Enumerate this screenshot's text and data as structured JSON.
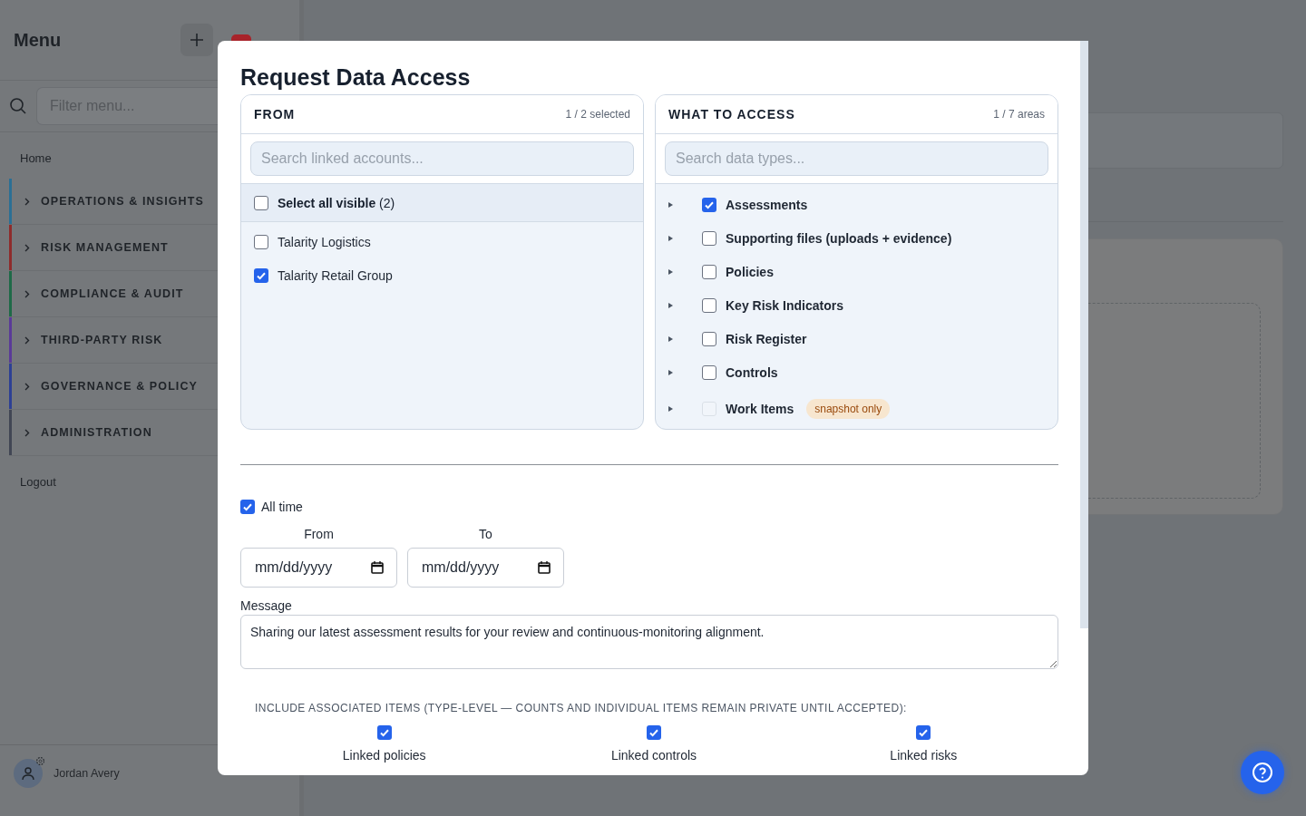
{
  "sidebar": {
    "title": "Menu",
    "filter": {
      "placeholder": "Filter menu..."
    },
    "items": [
      {
        "kind": "link",
        "label": "Home"
      },
      {
        "kind": "group",
        "label": "OPERATIONS & INSIGHTS",
        "color": "#2b6f95"
      },
      {
        "kind": "group",
        "label": "RISK MANAGEMENT",
        "color": "#8e2b2b"
      },
      {
        "kind": "group",
        "label": "COMPLIANCE & AUDIT",
        "color": "#1e6a47"
      },
      {
        "kind": "group",
        "label": "THIRD-PARTY RISK",
        "color": "#5a3a98"
      },
      {
        "kind": "group",
        "label": "GOVERNANCE & POLICY",
        "color": "#2d4094"
      },
      {
        "kind": "group",
        "label": "ADMINISTRATION",
        "color": "#414654"
      },
      {
        "kind": "link",
        "label": "Logout"
      }
    ],
    "user": {
      "name": "Jordan Avery"
    }
  },
  "dialog": {
    "title": "Request Data Access",
    "from_panel": {
      "heading": "FROM",
      "count": "1 / 2 selected",
      "search": {
        "placeholder": "Search linked accounts..."
      },
      "select_all": {
        "label": "Select all visible",
        "count": "(2)",
        "checked": false
      },
      "accounts": [
        {
          "name": "Talarity Logistics",
          "checked": false
        },
        {
          "name": "Talarity Retail Group",
          "checked": true
        }
      ]
    },
    "access_panel": {
      "heading": "WHAT TO ACCESS",
      "count": "1 / 7 areas",
      "search": {
        "placeholder": "Search data types..."
      },
      "areas": [
        {
          "label": "Assessments",
          "checked": true,
          "disabled": false
        },
        {
          "label": "Supporting files (uploads + evidence)",
          "checked": false,
          "disabled": false
        },
        {
          "label": "Policies",
          "checked": false,
          "disabled": false
        },
        {
          "label": "Key Risk Indicators",
          "checked": false,
          "disabled": false
        },
        {
          "label": "Risk Register",
          "checked": false,
          "disabled": false
        },
        {
          "label": "Controls",
          "checked": false,
          "disabled": false
        },
        {
          "label": "Work Items",
          "checked": false,
          "disabled": true,
          "badge": "snapshot only"
        }
      ]
    },
    "all_time": {
      "label": "All time",
      "checked": true
    },
    "date_from": {
      "label": "From",
      "placeholder": "mm/dd/yyyy"
    },
    "date_to": {
      "label": "To",
      "placeholder": "mm/dd/yyyy"
    },
    "message": {
      "label": "Message",
      "value": "Sharing our latest assessment results for your review and continuous-monitoring alignment."
    },
    "include": {
      "heading": "INCLUDE ASSOCIATED ITEMS (TYPE-LEVEL — COUNTS AND INDIVIDUAL ITEMS REMAIN PRIVATE UNTIL ACCEPTED):",
      "options": [
        {
          "label": "Linked policies",
          "checked": true
        },
        {
          "label": "Linked controls",
          "checked": true
        },
        {
          "label": "Linked risks",
          "checked": true
        }
      ]
    }
  }
}
